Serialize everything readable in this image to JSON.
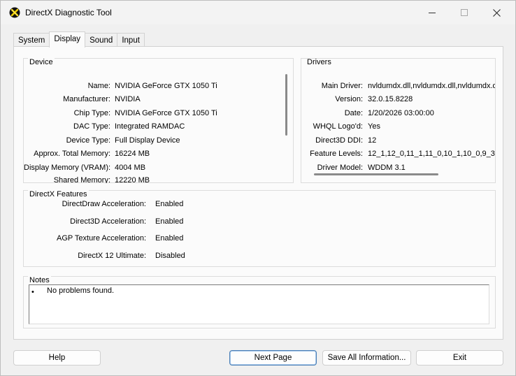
{
  "window": {
    "title": "DirectX Diagnostic Tool",
    "icon": "directx-x-icon",
    "controls": {
      "minimize": "minimize-icon",
      "maximize": "maximize-icon",
      "close": "close-icon"
    }
  },
  "tabs": [
    {
      "label": "System",
      "active": false
    },
    {
      "label": "Display",
      "active": true
    },
    {
      "label": "Sound",
      "active": false
    },
    {
      "label": "Input",
      "active": false
    }
  ],
  "device": {
    "title": "Device",
    "rows": [
      {
        "label": "Name:",
        "value": "NVIDIA GeForce GTX 1050 Ti"
      },
      {
        "label": "Manufacturer:",
        "value": "NVIDIA"
      },
      {
        "label": "Chip Type:",
        "value": "NVIDIA GeForce GTX 1050 Ti"
      },
      {
        "label": "DAC Type:",
        "value": "Integrated RAMDAC"
      },
      {
        "label": "Device Type:",
        "value": "Full Display Device"
      },
      {
        "label": "Approx. Total Memory:",
        "value": "16224 MB"
      },
      {
        "label": "Display Memory (VRAM):",
        "value": "4004 MB"
      },
      {
        "label": "Shared Memory:",
        "value": "12220 MB"
      }
    ]
  },
  "drivers": {
    "title": "Drivers",
    "rows": [
      {
        "label": "Main Driver:",
        "value": "nvldumdx.dll,nvldumdx.dll,nvldumdx.d"
      },
      {
        "label": "Version:",
        "value": "32.0.15.8228"
      },
      {
        "label": "Date:",
        "value": "1/20/2026 03:00:00"
      },
      {
        "label": "WHQL Logo'd:",
        "value": "Yes"
      },
      {
        "label": "Direct3D DDI:",
        "value": "12"
      },
      {
        "label": "Feature Levels:",
        "value": "12_1,12_0,11_1,11_0,10_1,10_0,9_3"
      },
      {
        "label": "Driver Model:",
        "value": "WDDM 3.1"
      }
    ]
  },
  "features": {
    "title": "DirectX Features",
    "rows": [
      {
        "label": "DirectDraw Acceleration:",
        "value": "Enabled"
      },
      {
        "label": "Direct3D Acceleration:",
        "value": "Enabled"
      },
      {
        "label": "AGP Texture Acceleration:",
        "value": "Enabled"
      },
      {
        "label": "DirectX 12 Ultimate:",
        "value": "Disabled"
      }
    ]
  },
  "notes": {
    "title": "Notes",
    "bullet": "•",
    "items": [
      "No problems found."
    ]
  },
  "buttons": {
    "help": "Help",
    "next": "Next Page",
    "save": "Save All Information...",
    "exit": "Exit"
  }
}
